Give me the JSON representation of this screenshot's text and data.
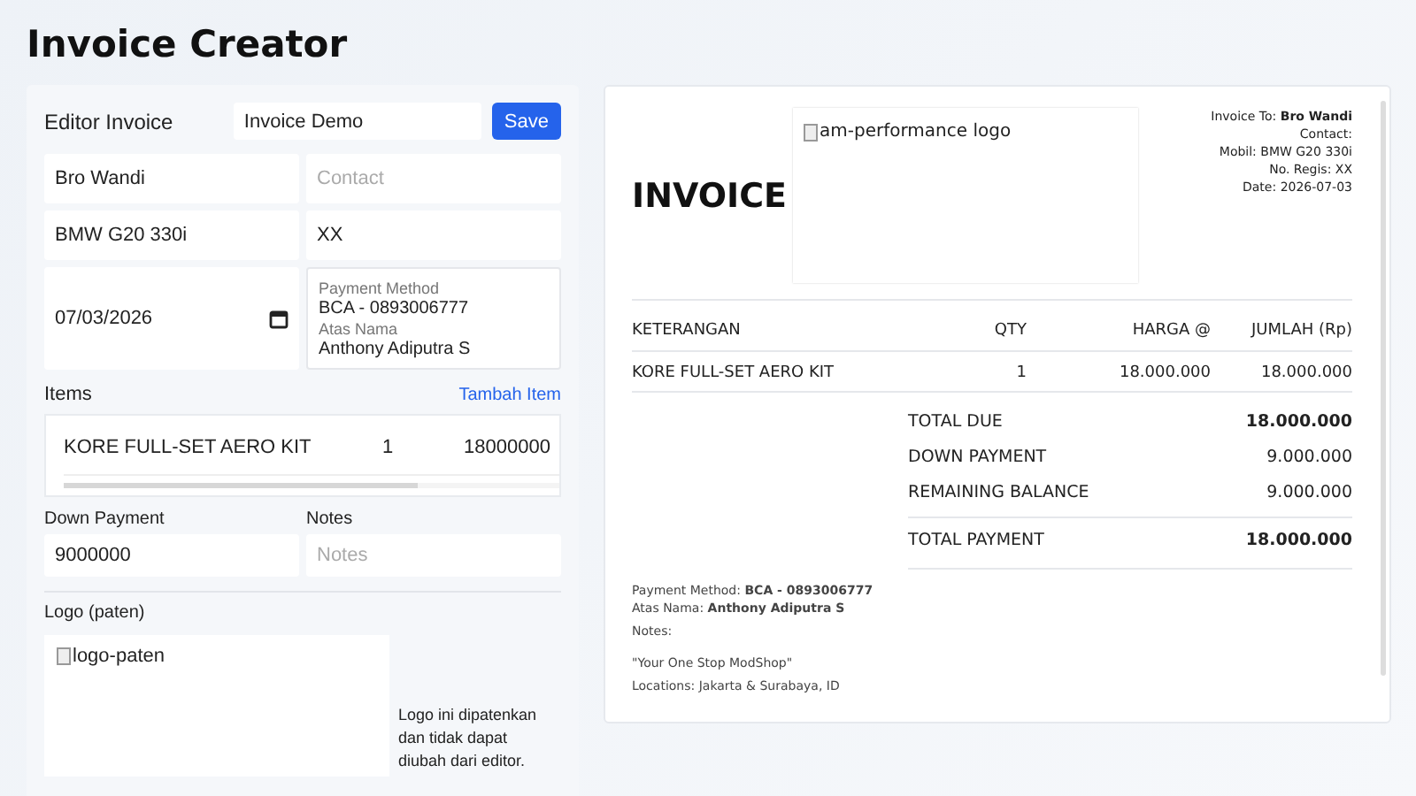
{
  "title": "Invoice Creator",
  "editor": {
    "heading": "Editor Invoice",
    "invoice_name": "Invoice Demo",
    "save": "Save",
    "fields": [
      {
        "value": "Bro Wandi"
      },
      {
        "placeholder": "Contact"
      },
      {
        "value": "BMW G20 330i"
      },
      {
        "value": "XX"
      }
    ],
    "date": "07/03/2026",
    "payment": {
      "method_label": "Payment Method",
      "method": "BCA - 0893006777",
      "name_label": "Atas Nama",
      "name": "Anthony Adiputra S"
    },
    "items_label": "Items",
    "add_item": "Tambah Item",
    "items": [
      {
        "description": "KORE FULL-SET AERO KIT",
        "qty": "1",
        "price": "18000000"
      }
    ],
    "down_payment_label": "Down Payment",
    "down_payment": "9000000",
    "notes_label": "Notes",
    "notes_placeholder": "Notes",
    "logo_label": "Logo (paten)",
    "logo_alt": "logo-paten",
    "logo_note": "Logo ini dipatenkan dan tidak dapat diubah dari editor."
  },
  "preview": {
    "heading": "INVOICE",
    "logo_alt": "am-performance logo",
    "meta": [
      "Invoice To: **Bro Wandi**",
      "Contact:",
      "Mobil: BMW G20 330i",
      "No. Regis: XX",
      "Date: 2026-07-03"
    ],
    "columns": [
      "KETERANGAN",
      "QTY",
      "HARGA @",
      "JUMLAH (Rp)"
    ],
    "rows": [
      [
        "KORE FULL-SET AERO KIT",
        "1",
        "18.000.000",
        "18.000.000"
      ]
    ],
    "totals": [
      {
        "label": "TOTAL DUE",
        "value": "18.000.000",
        "bold": true
      },
      {
        "label": "DOWN PAYMENT",
        "value": "9.000.000",
        "bold": false
      },
      {
        "label": "REMAINING BALANCE",
        "value": "9.000.000",
        "bold": false
      }
    ],
    "grand_total": {
      "label": "TOTAL PAYMENT",
      "value": "18.000.000"
    },
    "footer": [
      "Payment Method: **BCA - 0893006777**",
      "Atas Nama: **Anthony Adiputra S**"
    ],
    "notes": "Notes:",
    "tagline": "\"Your One Stop ModShop\"",
    "locations": "Locations: Jakarta & Surabaya, ID"
  }
}
